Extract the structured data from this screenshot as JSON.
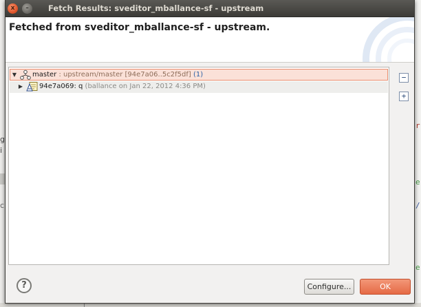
{
  "window": {
    "title": "Fetch Results: sveditor_mballance-sf - upstream",
    "close_glyph": "x",
    "minimize_glyph": "–"
  },
  "header": {
    "title": "Fetched from sveditor_mballance-sf - upstream."
  },
  "tree": {
    "rows": [
      {
        "expander": "▼",
        "icon": "branch-icon",
        "name": "master",
        "detail": " : upstream/master [94e7a06..5c2f5df]",
        "count": " (1)",
        "selected": true
      },
      {
        "expander": "▶",
        "icon": "commit-icon",
        "name": "94e7a069: q",
        "detail": " (ballance on Jan 22, 2012 4:36 PM)",
        "selected": false
      }
    ]
  },
  "tools": {
    "collapse_glyph": "−",
    "expand_glyph": "+"
  },
  "footer": {
    "help_glyph": "?",
    "configure_label": "Configure...",
    "ok_label": "OK"
  },
  "colors": {
    "titlebar": "#3c3b37",
    "selection_bg": "#fbe1d8",
    "selection_border": "#e88d6f",
    "ok_button": "#e56a45"
  }
}
